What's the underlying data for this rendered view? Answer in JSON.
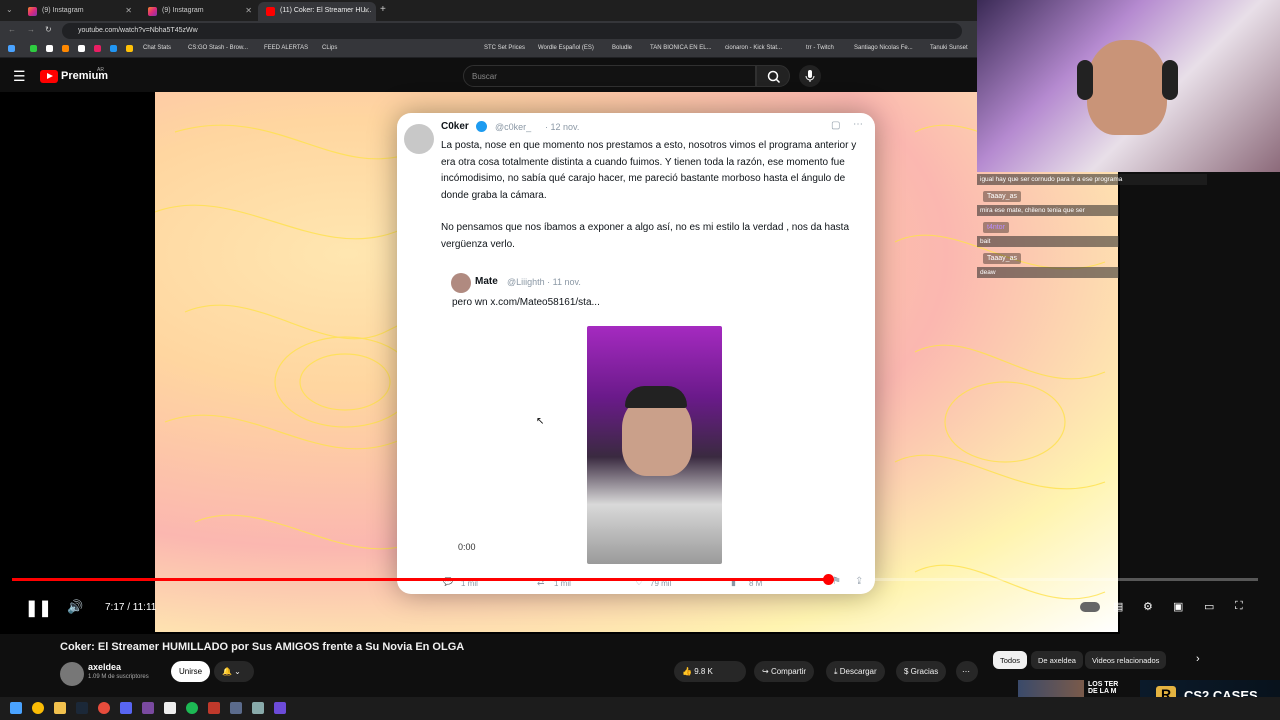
{
  "tabs": [
    {
      "label": "(9) Instagram",
      "close": "✕"
    },
    {
      "label": "(9) Instagram",
      "close": "✕"
    },
    {
      "label": "(11) Coker: El Streamer HU...",
      "close": "✕"
    }
  ],
  "new_tab": "+",
  "address": {
    "url": "youtube.com/watch?v=Nbha5T45zWw"
  },
  "bookmarks": [
    "Chat Stats",
    "CS:GO Stash - Brow...",
    "FEED ALERTAS",
    "CLips",
    "STC Set Prices",
    "Wordle Español (ES)",
    "Boludle",
    "TAN BIONICA EN EL...",
    "cionaron - Kick Stat...",
    "trr - Twitch",
    "Santiago Nicolas Fe...",
    "Tanuki Sunset"
  ],
  "youtube": {
    "brand": "Premium",
    "brand_sup": "AR",
    "search_placeholder": "Buscar"
  },
  "tweet": {
    "author": "C0ker",
    "handle": "@c0ker_",
    "date": "· 12 nov.",
    "paragraph1": "La posta, nose en que momento nos prestamos a esto, nosotros vimos el programa anterior y era otra cosa totalmente distinta a cuando fuimos. Y tienen toda la razón, ese momento fue incómodisimo, no sabía qué carajo hacer, me pareció bastante morboso hasta el ángulo de donde graba la cámara.",
    "paragraph2": "No pensamos que nos íbamos a exponer a algo así, no es mi estilo la verdad , nos da hasta vergüenza verlo.",
    "quoted_author": "Mate",
    "quoted_handle": "@Liiighth · 11 nov.",
    "quoted_text": "pero wn  x.com/Mateo58161/sta...",
    "video_time": "0:00",
    "replies": "1 mil",
    "retweets": "1 mil",
    "likes": "79 mil",
    "views": "8 M"
  },
  "chat": [
    {
      "user": "",
      "text": "igual hay que ser cornudo para ir a ese programa"
    },
    {
      "user": "Taaay_as",
      "text": "mira ese mate, chileno tenia que ser"
    },
    {
      "user": "t4ntor",
      "text": "bait"
    },
    {
      "user": "Taaay_as",
      "text": "deaw"
    }
  ],
  "player": {
    "time": "7:17 / 11:11",
    "progress": 0.655
  },
  "video": {
    "title": "Coker: El Streamer HUMILLADO por Sus AMIGOS frente a Su Novia En OLGA",
    "channel": "axeldea",
    "subscribers": "1.09 M de suscriptores",
    "join": "Unirse",
    "likes": "9.8 K",
    "share": "Compartir",
    "download": "Descargar",
    "thanks": "Gracias"
  },
  "chips": [
    "Todos",
    "De axeldea",
    "Videos relacionados"
  ],
  "related_title": "LOS TER\nDE LA M",
  "overlay_brand": "CS2 CASES",
  "colors": {
    "accent": "#ff0000",
    "bg": "#0f0f0f"
  }
}
